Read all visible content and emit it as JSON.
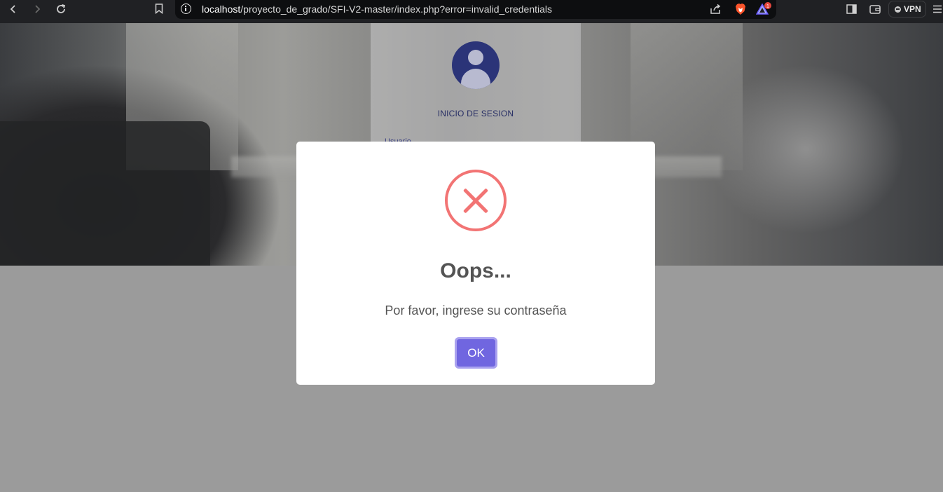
{
  "browser": {
    "url_host": "localhost",
    "url_path": "/proyecto_de_grado/SFI-V2-master/index.php?error=invalid_credentials",
    "vpn_label": "VPN",
    "notification_count": "1",
    "icons": [
      "back-icon",
      "forward-icon",
      "reload-icon",
      "bookmark-icon",
      "site-info-icon",
      "share-icon",
      "brave-shields-icon",
      "brave-rewards-icon",
      "sidebar-icon",
      "wallet-icon",
      "menu-icon"
    ]
  },
  "login": {
    "title": "INICIO DE SESION",
    "user_label": "Usuario"
  },
  "dialog": {
    "title": "Oops...",
    "message": "Por favor, ingrese su contraseña",
    "ok_label": "OK",
    "icon": "error-x-icon",
    "icon_color": "#f27474",
    "button_color": "#7066e0"
  }
}
